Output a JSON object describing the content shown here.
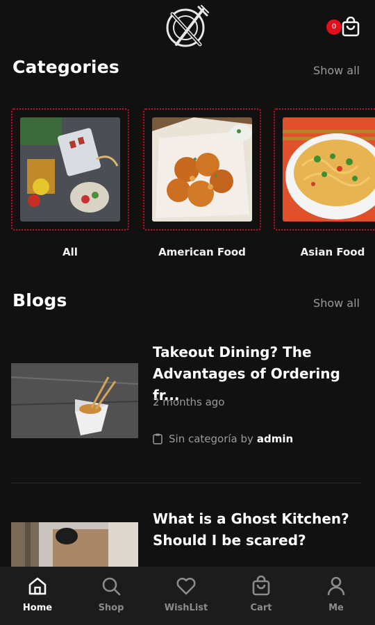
{
  "header": {
    "logo_icon": "plate-fork-knife-icon",
    "cart_icon": "shopping-bag-icon",
    "cart_count": "0"
  },
  "categories": {
    "title": "Categories",
    "show_all": "Show all",
    "items": [
      {
        "label": "All",
        "image": "fresh-produce-photo"
      },
      {
        "label": "American Food",
        "image": "fried-chicken-photo"
      },
      {
        "label": "Asian Food",
        "image": "noodles-bowl-photo"
      }
    ]
  },
  "blogs": {
    "title": "Blogs",
    "show_all": "Show all",
    "items": [
      {
        "title": "Takeout Dining? The Advantages of Ordering fr...",
        "date": "2 months ago",
        "category": "Sin categoría by",
        "author": "admin",
        "image": "takeout-box-photo"
      },
      {
        "title": "What is a Ghost Kitchen? Should I be scared?",
        "image": "delivery-bag-photo"
      }
    ]
  },
  "bottom_nav": [
    {
      "label": "Home",
      "icon": "home-icon",
      "active": true
    },
    {
      "label": "Shop",
      "icon": "search-icon",
      "active": false
    },
    {
      "label": "WishList",
      "icon": "heart-icon",
      "active": false
    },
    {
      "label": "Cart",
      "icon": "shopping-bag-icon",
      "active": false
    },
    {
      "label": "Me",
      "icon": "user-icon",
      "active": false
    }
  ],
  "colors": {
    "background": "#111111",
    "accent": "#e0101e",
    "muted_text": "#9a9a9a",
    "nav_background": "#1c1c1c"
  }
}
